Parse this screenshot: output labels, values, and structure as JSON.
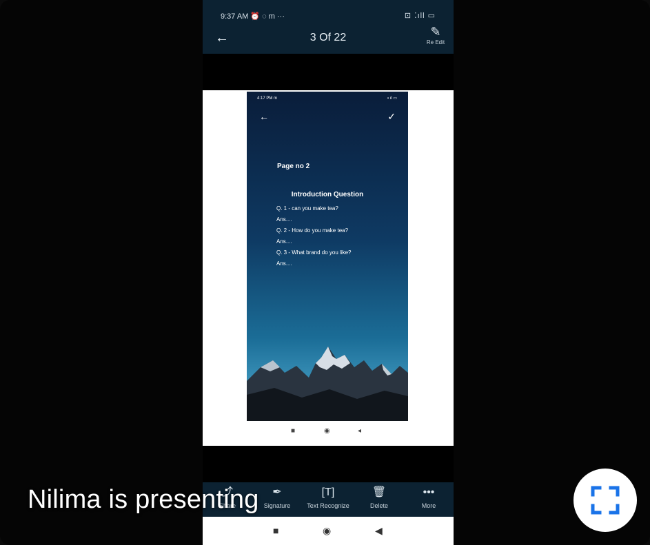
{
  "status": {
    "time": "9:37 AM",
    "time_icons": "⏰ ◌ m ···",
    "sys_icons": "⊡ ⁚ıll ▭"
  },
  "toolbar": {
    "back_icon": "back-arrow-icon",
    "title": "3 Of 22",
    "reedit_label": "Re Edit"
  },
  "screenshot": {
    "status_time": "4:17 PM m",
    "status_sys": "▪ ıl ▭",
    "page_label": "Page no 2",
    "title": "Introduction Question",
    "lines": [
      "Q. 1 - can you make tea?",
      "Ans....",
      "Q. 2 - How do you make tea?",
      "Ans....",
      "Q. 3 - What brand do you like?",
      "Ans...."
    ]
  },
  "bottombar": {
    "items": [
      {
        "label": "Share",
        "icon": "share-icon"
      },
      {
        "label": "Signature",
        "icon": "signature-pen-icon"
      },
      {
        "label": "Text Recognize",
        "icon": "text-recognize-icon"
      },
      {
        "label": "Delete",
        "icon": "trash-icon"
      },
      {
        "label": "More",
        "icon": "more-dots-icon"
      }
    ]
  },
  "presenter": {
    "text": "Nilima is presenting"
  },
  "colors": {
    "bar": "#0c2232",
    "accent": "#1a73e8",
    "page": "#ffffff"
  }
}
